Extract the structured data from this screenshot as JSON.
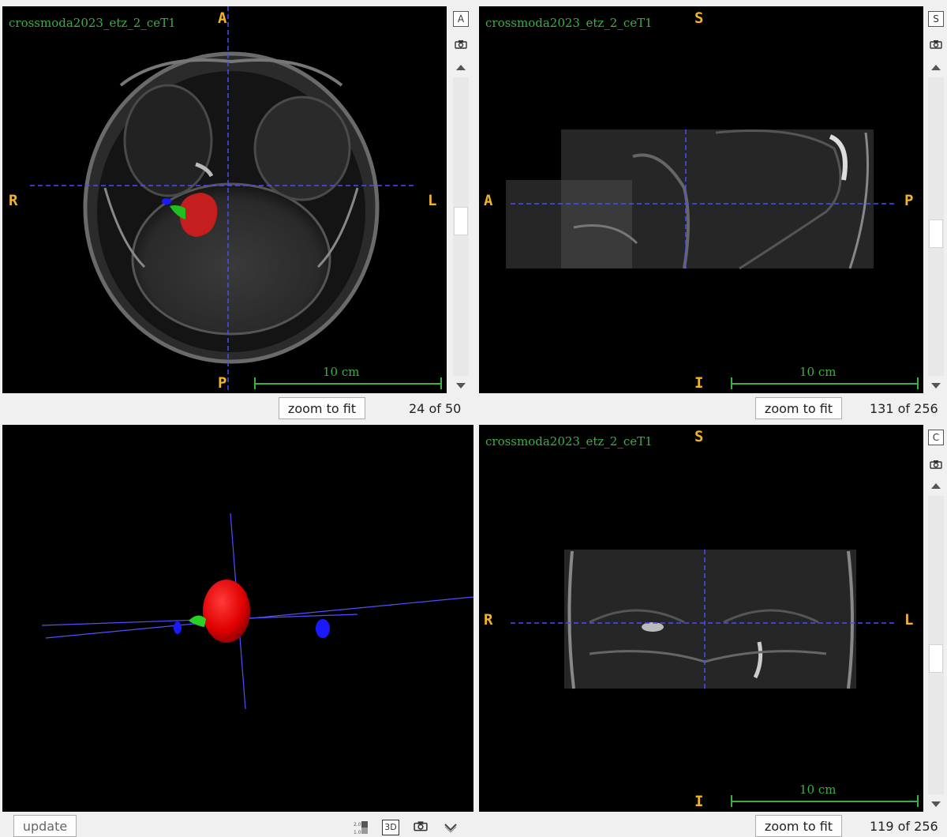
{
  "image_name": "crossmoda2023_etz_2_ceT1",
  "zoom_label": "zoom to fit",
  "scale_label": "10 cm",
  "update_label": "update",
  "three_d_label": "3D",
  "views": {
    "axial": {
      "button": "A",
      "top": "A",
      "bottom": "P",
      "left": "R",
      "right": "L",
      "slice": "24 of 50"
    },
    "sagittal": {
      "button": "S",
      "top": "S",
      "bottom": "I",
      "left": "A",
      "right": "P",
      "slice": "131 of 256"
    },
    "coronal": {
      "button": "C",
      "top": "S",
      "bottom": "I",
      "left": "R",
      "right": "L",
      "slice": "119 of 256"
    }
  },
  "colors": {
    "title_green": "#3cb043",
    "orientation_orange": "#f0b428",
    "crosshair": "#4b4bff",
    "label_red": "#d82020",
    "label_green": "#20c020",
    "label_blue": "#1a1aff"
  },
  "icons": [
    "camera-icon",
    "scroll-up-arrow-icon",
    "scroll-down-arrow-icon",
    "layout-icon",
    "3d-icon",
    "chevron-down-icon"
  ]
}
